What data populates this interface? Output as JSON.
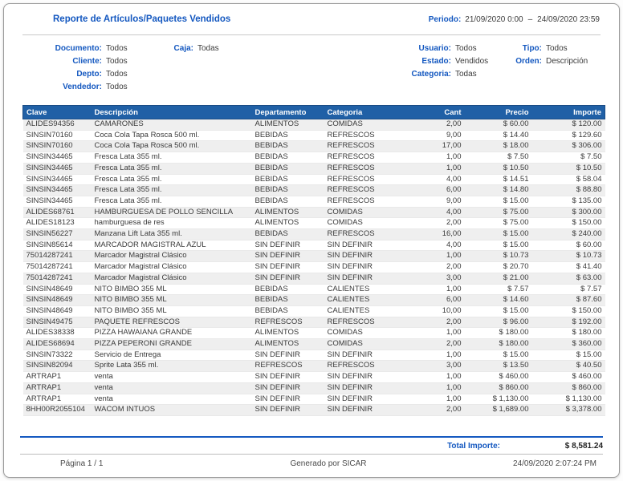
{
  "header": {
    "title": "Reporte de Artículos/Paquetes Vendidos",
    "period_label": "Periodo:",
    "period_start": "21/09/2020 0:00",
    "period_separator": "–",
    "period_end": "24/09/2020 23:59"
  },
  "filters": {
    "col1": [
      {
        "label": "Documento:",
        "value": "Todos"
      },
      {
        "label": "Cliente:",
        "value": "Todos"
      },
      {
        "label": "Depto:",
        "value": "Todos"
      },
      {
        "label": "Vendedor:",
        "value": "Todos"
      }
    ],
    "col2": [
      {
        "label": "Caja:",
        "value": "Todas"
      }
    ],
    "col3": [
      {
        "label": "Usuario:",
        "value": "Todos"
      },
      {
        "label": "Estado:",
        "value": "Vendidos"
      },
      {
        "label": "Categoria:",
        "value": "Todas"
      }
    ],
    "col4": [
      {
        "label": "Tipo:",
        "value": "Todos"
      },
      {
        "label": "Orden:",
        "value": "Descripción"
      }
    ]
  },
  "table": {
    "columns": [
      "Clave",
      "Descripción",
      "Departamento",
      "Categoria",
      "Cant",
      "Precio",
      "Importe"
    ],
    "rows": [
      [
        "ALIDES94356",
        "CAMARONES",
        "ALIMENTOS",
        "COMIDAS",
        "2,00",
        "$ 60.00",
        "$ 120.00"
      ],
      [
        "SINSIN70160",
        "Coca Cola Tapa Rosca 500 ml.",
        "BEBIDAS",
        "REFRESCOS",
        "9,00",
        "$ 14.40",
        "$ 129.60"
      ],
      [
        "SINSIN70160",
        "Coca Cola Tapa Rosca 500 ml.",
        "BEBIDAS",
        "REFRESCOS",
        "17,00",
        "$ 18.00",
        "$ 306.00"
      ],
      [
        "SINSIN34465",
        "Fresca Lata 355 ml.",
        "BEBIDAS",
        "REFRESCOS",
        "1,00",
        "$ 7.50",
        "$ 7.50"
      ],
      [
        "SINSIN34465",
        "Fresca Lata 355 ml.",
        "BEBIDAS",
        "REFRESCOS",
        "1,00",
        "$ 10.50",
        "$ 10.50"
      ],
      [
        "SINSIN34465",
        "Fresca Lata 355 ml.",
        "BEBIDAS",
        "REFRESCOS",
        "4,00",
        "$ 14.51",
        "$ 58.04"
      ],
      [
        "SINSIN34465",
        "Fresca Lata 355 ml.",
        "BEBIDAS",
        "REFRESCOS",
        "6,00",
        "$ 14.80",
        "$ 88.80"
      ],
      [
        "SINSIN34465",
        "Fresca Lata 355 ml.",
        "BEBIDAS",
        "REFRESCOS",
        "9,00",
        "$ 15.00",
        "$ 135.00"
      ],
      [
        "ALIDES68761",
        "HAMBURGUESA DE POLLO SENCILLA",
        "ALIMENTOS",
        "COMIDAS",
        "4,00",
        "$ 75.00",
        "$ 300.00"
      ],
      [
        "ALIDES18123",
        "hamburguesa de res",
        "ALIMENTOS",
        "COMIDAS",
        "2,00",
        "$ 75.00",
        "$ 150.00"
      ],
      [
        "SINSIN56227",
        "Manzana Lift Lata 355 ml.",
        "BEBIDAS",
        "REFRESCOS",
        "16,00",
        "$ 15.00",
        "$ 240.00"
      ],
      [
        "SINSIN85614",
        "MARCADOR MAGISTRAL AZUL",
        "SIN DEFINIR",
        "SIN DEFINIR",
        "4,00",
        "$ 15.00",
        "$ 60.00"
      ],
      [
        "75014287241",
        "Marcador Magistral Clásico",
        "SIN DEFINIR",
        "SIN DEFINIR",
        "1,00",
        "$ 10.73",
        "$ 10.73"
      ],
      [
        "75014287241",
        "Marcador Magistral Clásico",
        "SIN DEFINIR",
        "SIN DEFINIR",
        "2,00",
        "$ 20.70",
        "$ 41.40"
      ],
      [
        "75014287241",
        "Marcador Magistral Clásico",
        "SIN DEFINIR",
        "SIN DEFINIR",
        "3,00",
        "$ 21.00",
        "$ 63.00"
      ],
      [
        "SINSIN48649",
        "NITO BIMBO 355 ML",
        "BEBIDAS",
        "CALIENTES",
        "1,00",
        "$ 7.57",
        "$ 7.57"
      ],
      [
        "SINSIN48649",
        "NITO BIMBO 355 ML",
        "BEBIDAS",
        "CALIENTES",
        "6,00",
        "$ 14.60",
        "$ 87.60"
      ],
      [
        "SINSIN48649",
        "NITO BIMBO 355 ML",
        "BEBIDAS",
        "CALIENTES",
        "10,00",
        "$ 15.00",
        "$ 150.00"
      ],
      [
        "SINSIN49475",
        "PAQUETE REFRESCOS",
        "REFRESCOS",
        "REFRESCOS",
        "2,00",
        "$ 96.00",
        "$ 192.00"
      ],
      [
        "ALIDES38338",
        "PIZZA HAWAIANA GRANDE",
        "ALIMENTOS",
        "COMIDAS",
        "1,00",
        "$ 180.00",
        "$ 180.00"
      ],
      [
        "ALIDES68694",
        "PIZZA PEPERONI GRANDE",
        "ALIMENTOS",
        "COMIDAS",
        "2,00",
        "$ 180.00",
        "$ 360.00"
      ],
      [
        "SINSIN73322",
        "Servicio de Entrega",
        "SIN DEFINIR",
        "SIN DEFINIR",
        "1,00",
        "$ 15.00",
        "$ 15.00"
      ],
      [
        "SINSIN82094",
        "Sprite Lata 355 ml.",
        "REFRESCOS",
        "REFRESCOS",
        "3,00",
        "$ 13.50",
        "$ 40.50"
      ],
      [
        "ARTRAP1",
        "venta",
        "SIN DEFINIR",
        "SIN DEFINIR",
        "1,00",
        "$ 460.00",
        "$ 460.00"
      ],
      [
        "ARTRAP1",
        "venta",
        "SIN DEFINIR",
        "SIN DEFINIR",
        "1,00",
        "$ 860.00",
        "$ 860.00"
      ],
      [
        "ARTRAP1",
        "venta",
        "SIN DEFINIR",
        "SIN DEFINIR",
        "1,00",
        "$ 1,130.00",
        "$ 1,130.00"
      ],
      [
        "8HH00R2055104",
        "WACOM INTUOS",
        "SIN DEFINIR",
        "SIN DEFINIR",
        "2,00",
        "$ 1,689.00",
        "$ 3,378.00"
      ]
    ]
  },
  "totals": {
    "label": "Total Importe:",
    "value": "$ 8,581.24"
  },
  "footer": {
    "page": "Página 1 / 1",
    "generated": "Generado por SICAR",
    "datetime": "24/09/2020 2:07:24 PM"
  },
  "colors": {
    "accent_blue": "#1458c0",
    "table_header_bg": "#2060a6",
    "row_alt_bg": "#efefef"
  }
}
